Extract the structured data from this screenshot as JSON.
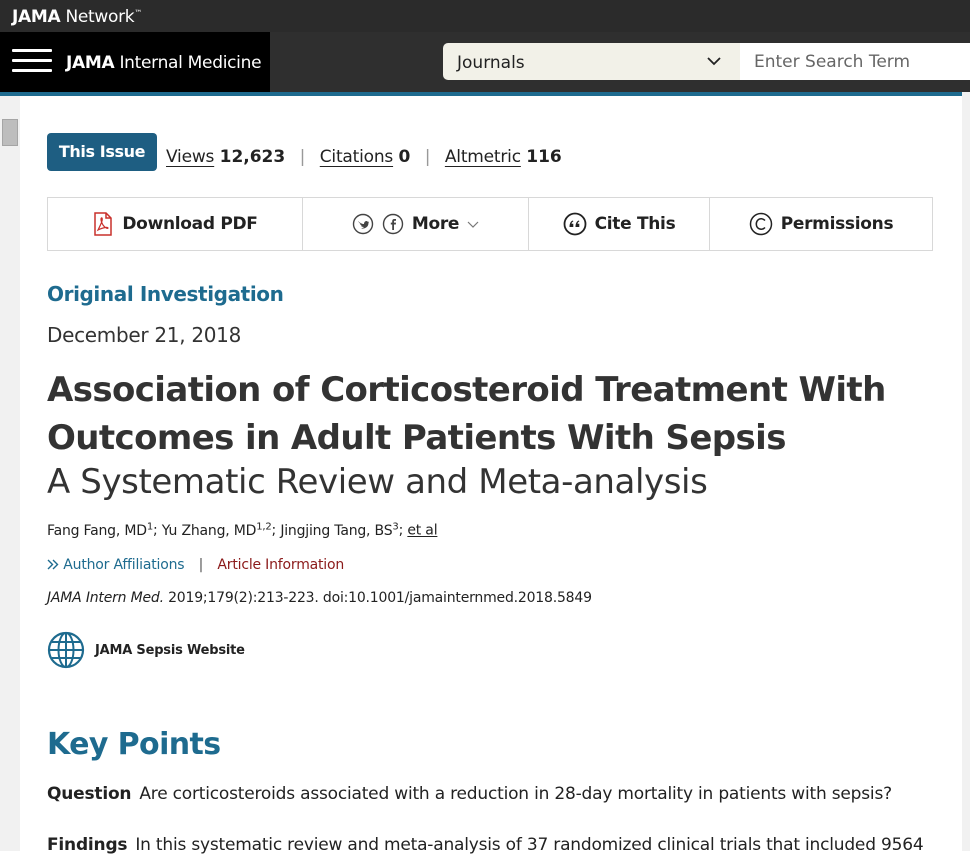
{
  "topbar": {
    "network_bold": "JAMA",
    "network_rest": " Network"
  },
  "header": {
    "brand_bold": "JAMA",
    "brand_rest": " Internal Medicine",
    "journals_label": "Journals",
    "search_placeholder": "Enter Search Term"
  },
  "article_meta": {
    "this_issue": "This Issue",
    "metrics": [
      {
        "label": "Views",
        "value": "12,623"
      },
      {
        "label": "Citations",
        "value": "0"
      },
      {
        "label": "Altmetric",
        "value": "116"
      }
    ]
  },
  "toolbar": {
    "download_pdf": "Download PDF",
    "more": "More",
    "cite_this": "Cite This",
    "permissions": "Permissions"
  },
  "article": {
    "type": "Original Investigation",
    "date": "December 21, 2018",
    "title": "Association of Corticosteroid Treatment With Outcomes in Adult Patients With Sepsis",
    "subtitle": "A Systematic Review and Meta-analysis",
    "authors": [
      {
        "name": "Fang Fang, MD",
        "sup": "1"
      },
      {
        "name": "Yu Zhang, MD",
        "sup": "1,2"
      },
      {
        "name": "Jingjing Tang, BS",
        "sup": "3"
      }
    ],
    "et_al": "et al",
    "author_affiliations": "Author Affiliations",
    "article_information": "Article Information",
    "journal_abbrev": "JAMA Intern Med.",
    "citation_rest": " 2019;179(2):213-223. doi:10.1001/jamainternmed.2018.5849",
    "sepsis_link": "JAMA Sepsis Website"
  },
  "key_points": {
    "heading": "Key Points",
    "question_label": "Question",
    "question_text": "Are corticosteroids associated with a reduction in 28-day mortality in patients with sepsis?",
    "findings_label": "Findings",
    "findings_text": "In this systematic review and meta-analysis of 37 randomized clinical trials that included 9564"
  },
  "colors": {
    "accent_blue": "#1e6b8f",
    "this_issue_bg": "#1e5e82",
    "article_info_red": "#8b1a1a",
    "topbar_bg": "#2b2b2b"
  }
}
